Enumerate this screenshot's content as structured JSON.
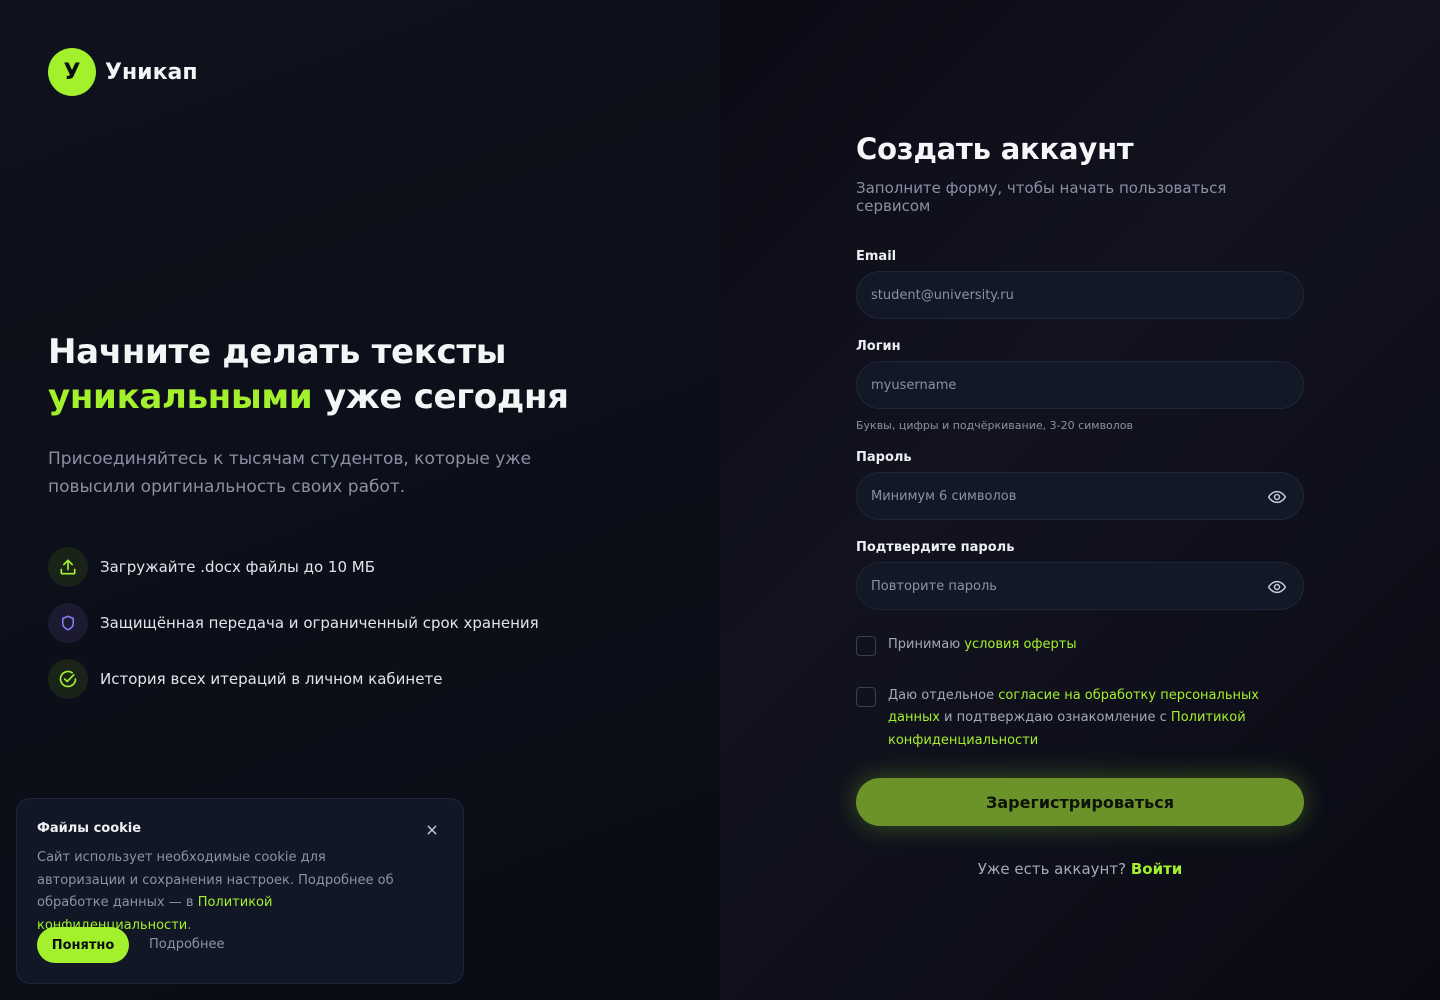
{
  "brand": {
    "mark": "У",
    "name": "Уникап"
  },
  "hero": {
    "title_line1": "Начните делать тексты",
    "title_accent": "уникальными",
    "title_rest": "уже сегодня",
    "lead": "Присоединяйтесь к тысячам студентов, которые уже повысили оригинальность своих работ."
  },
  "features": [
    {
      "icon": "upload-icon",
      "text": "Загружайте .docx файлы до 10 МБ"
    },
    {
      "icon": "shield-icon",
      "text": "Защищённая передача и ограниченный срок хранения"
    },
    {
      "icon": "check-circle-icon",
      "text": "История всех итераций в личном кабинете"
    }
  ],
  "cookie": {
    "title": "Файлы cookie",
    "text": "Сайт использует необходимые cookie для авторизации и сохранения настроек. Подробнее об обработке данных — в ",
    "link": "Политикой конфиденциальности",
    "text_end": ".",
    "ok_label": "Понятно",
    "more_label": "Подробнее"
  },
  "form": {
    "title": "Создать аккаунт",
    "subtitle": "Заполните форму, чтобы начать пользоваться сервисом",
    "email": {
      "label": "Email",
      "placeholder": "student@university.ru"
    },
    "login": {
      "label": "Логин",
      "placeholder": "myusername",
      "hint": "Буквы, цифры и подчёркивание, 3-20 символов"
    },
    "password": {
      "label": "Пароль",
      "placeholder": "Минимум 6 символов"
    },
    "confirm": {
      "label": "Подтвердите пароль",
      "placeholder": "Повторите пароль"
    },
    "offer": {
      "prefix": "Принимаю ",
      "link": "условия оферты"
    },
    "consent": {
      "prefix": "Даю отдельное ",
      "link1": "согласие на обработку персональных данных",
      "middle": " и подтверждаю ознакомление с ",
      "link2": "Политикой конфиденциальности"
    },
    "submit_label": "Зарегистрироваться",
    "have_account": "Уже есть аккаунт? ",
    "login_link": "Войти"
  },
  "colors": {
    "accent": "#a3f02c",
    "button": "#6b9329",
    "background": "#0c0e17"
  }
}
